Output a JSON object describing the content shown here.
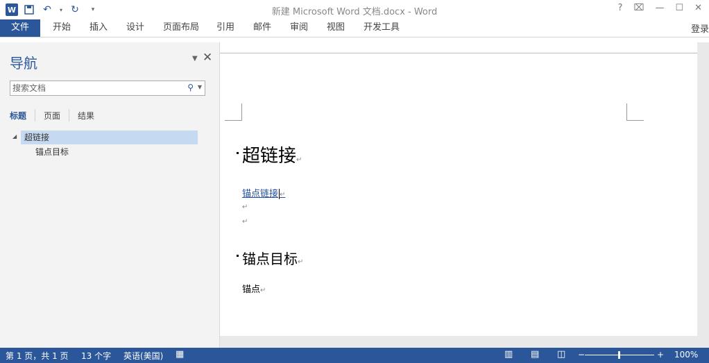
{
  "titlebar": {
    "title": "新建 Microsoft Word 文档.docx - Word",
    "qat_icons": [
      "word-logo",
      "save-icon",
      "undo-icon",
      "undo-dropdown-icon",
      "redo-icon",
      "customize-qat-icon"
    ],
    "controls": {
      "help": "?",
      "restore_ribbon": "⌧",
      "minimize": "—",
      "maximize": "☐",
      "close": "✕"
    }
  },
  "ribbon": {
    "tabs": [
      "文件",
      "开始",
      "插入",
      "设计",
      "页面布局",
      "引用",
      "邮件",
      "审阅",
      "视图",
      "开发工具"
    ],
    "login": "登录"
  },
  "nav": {
    "title": "导航",
    "search_placeholder": "搜索文档",
    "tabs": [
      "标题",
      "页面",
      "结果"
    ],
    "headings": [
      "超链接",
      "锚点目标"
    ]
  },
  "doc": {
    "h1": "超链接",
    "link": "锚点链接",
    "h2": "锚点目标",
    "body": "锚点",
    "paragraph_mark": "↵"
  },
  "status": {
    "page": "第 1 页，共 1 页",
    "words": "13 个字",
    "language": "英语(美国)",
    "zoom": "100%",
    "zoom_minus": "−",
    "zoom_plus": "+"
  },
  "colors": {
    "accent": "#2b579a",
    "nav_selected": "#c5d9f1",
    "link": "#1f4e9c"
  }
}
